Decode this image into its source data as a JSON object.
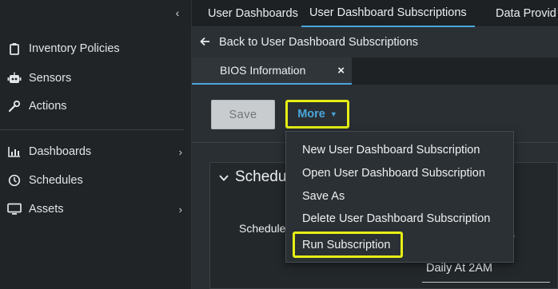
{
  "sidebar": {
    "items": [
      {
        "label": "Inventory Policies"
      },
      {
        "label": "Sensors"
      },
      {
        "label": "Actions"
      },
      {
        "label": "Dashboards"
      },
      {
        "label": "Schedules"
      },
      {
        "label": "Assets"
      }
    ]
  },
  "top_tabs": [
    "User Dashboards",
    "User Dashboard Subscriptions",
    "Data Provid"
  ],
  "back_link": "Back to User Dashboard Subscriptions",
  "sub_tab": {
    "label": "BIOS Information",
    "close": "×"
  },
  "toolbar": {
    "save_label": "Save",
    "more_label": "More"
  },
  "menu": {
    "items": [
      "New User Dashboard Subscription",
      "Open User Dashboard Subscription",
      "Save As",
      "Delete User Dashboard Subscription",
      "Run Subscription"
    ]
  },
  "panel": {
    "title": "Schedu",
    "field_label": "Schedule",
    "field_tail": "s",
    "schedule_value": "Daily At 2AM"
  },
  "colors": {
    "accent": "#4aa6db",
    "highlight": "#e6ef14"
  }
}
